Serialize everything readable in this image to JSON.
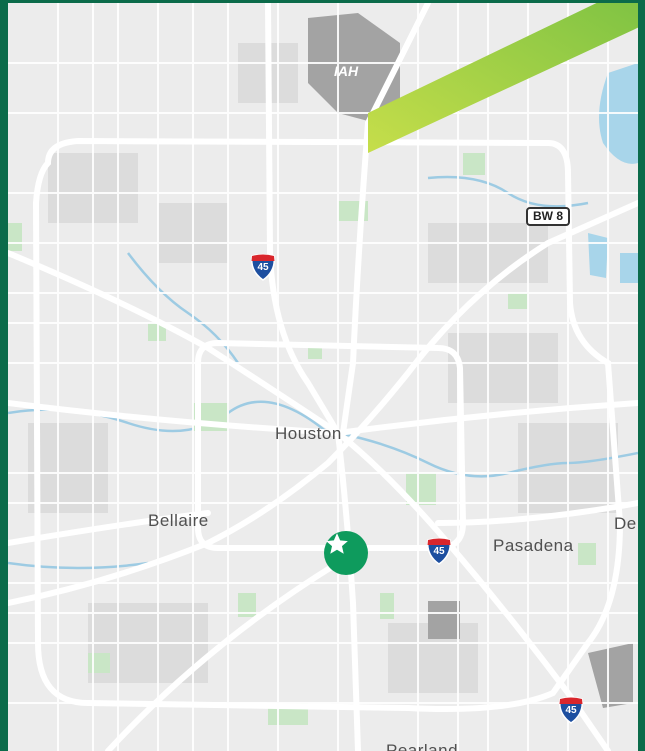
{
  "map": {
    "labels": {
      "houston": "Houston",
      "bellaire": "Bellaire",
      "pasadena": "Pasadena",
      "deer_park_partial": "De",
      "pearland_partial": "Pearland",
      "airport": "IAH"
    },
    "shields": {
      "i45_north": "45",
      "i45_south_east": "45",
      "i45_far_south": "45",
      "beltway": "BW 8"
    },
    "marker": {
      "type": "star",
      "color": "#0e9b5d"
    },
    "colors": {
      "frame": "#0b6b4a",
      "land": "#ececec",
      "road": "#ffffff",
      "park": "#c9e6c6",
      "water": "#a8d5ea",
      "accent_stripe_start": "#c6de4a",
      "accent_stripe_end": "#7ac143"
    }
  }
}
